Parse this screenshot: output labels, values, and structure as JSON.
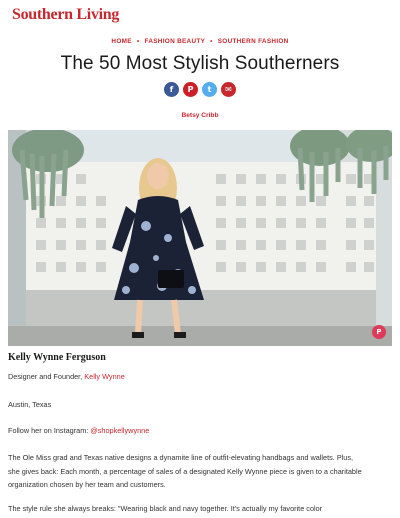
{
  "site": {
    "logo": "Southern Living"
  },
  "breadcrumb": {
    "items": [
      "HOME",
      "FASHION BEAUTY",
      "SOUTHERN FASHION"
    ],
    "separator": "•"
  },
  "article": {
    "title": "The 50 Most Stylish Southerners",
    "author": "Betsy Cribb"
  },
  "share": {
    "facebook_icon": "f",
    "pinterest_icon": "P",
    "twitter_icon": "t",
    "email_icon": "✉"
  },
  "hero": {
    "pin_icon": "P"
  },
  "entry": {
    "name": "Kelly Wynne Ferguson",
    "role_prefix": "Designer and Founder, ",
    "role_link": "Kelly Wynne",
    "location": "Austin, Texas",
    "instagram_prefix": "Follow her on Instagram: ",
    "instagram_handle": "@shopkellywynne",
    "bio_line1": "The Ole Miss grad and Texas native designs a dynamite line of outfit-elevating handbags and wallets. Plus,",
    "bio_line2": "she gives back: Each month, a percentage of sales of a designated Kelly Wynne piece is given to a charitable",
    "bio_line3": "organization chosen by her team and customers.",
    "style_rule": "The style rule she always breaks: \"Wearing black and navy together. It's actually my favorite color"
  },
  "colors": {
    "brand": "#c7282e",
    "facebook": "#3b5998",
    "twitter": "#55acee"
  }
}
